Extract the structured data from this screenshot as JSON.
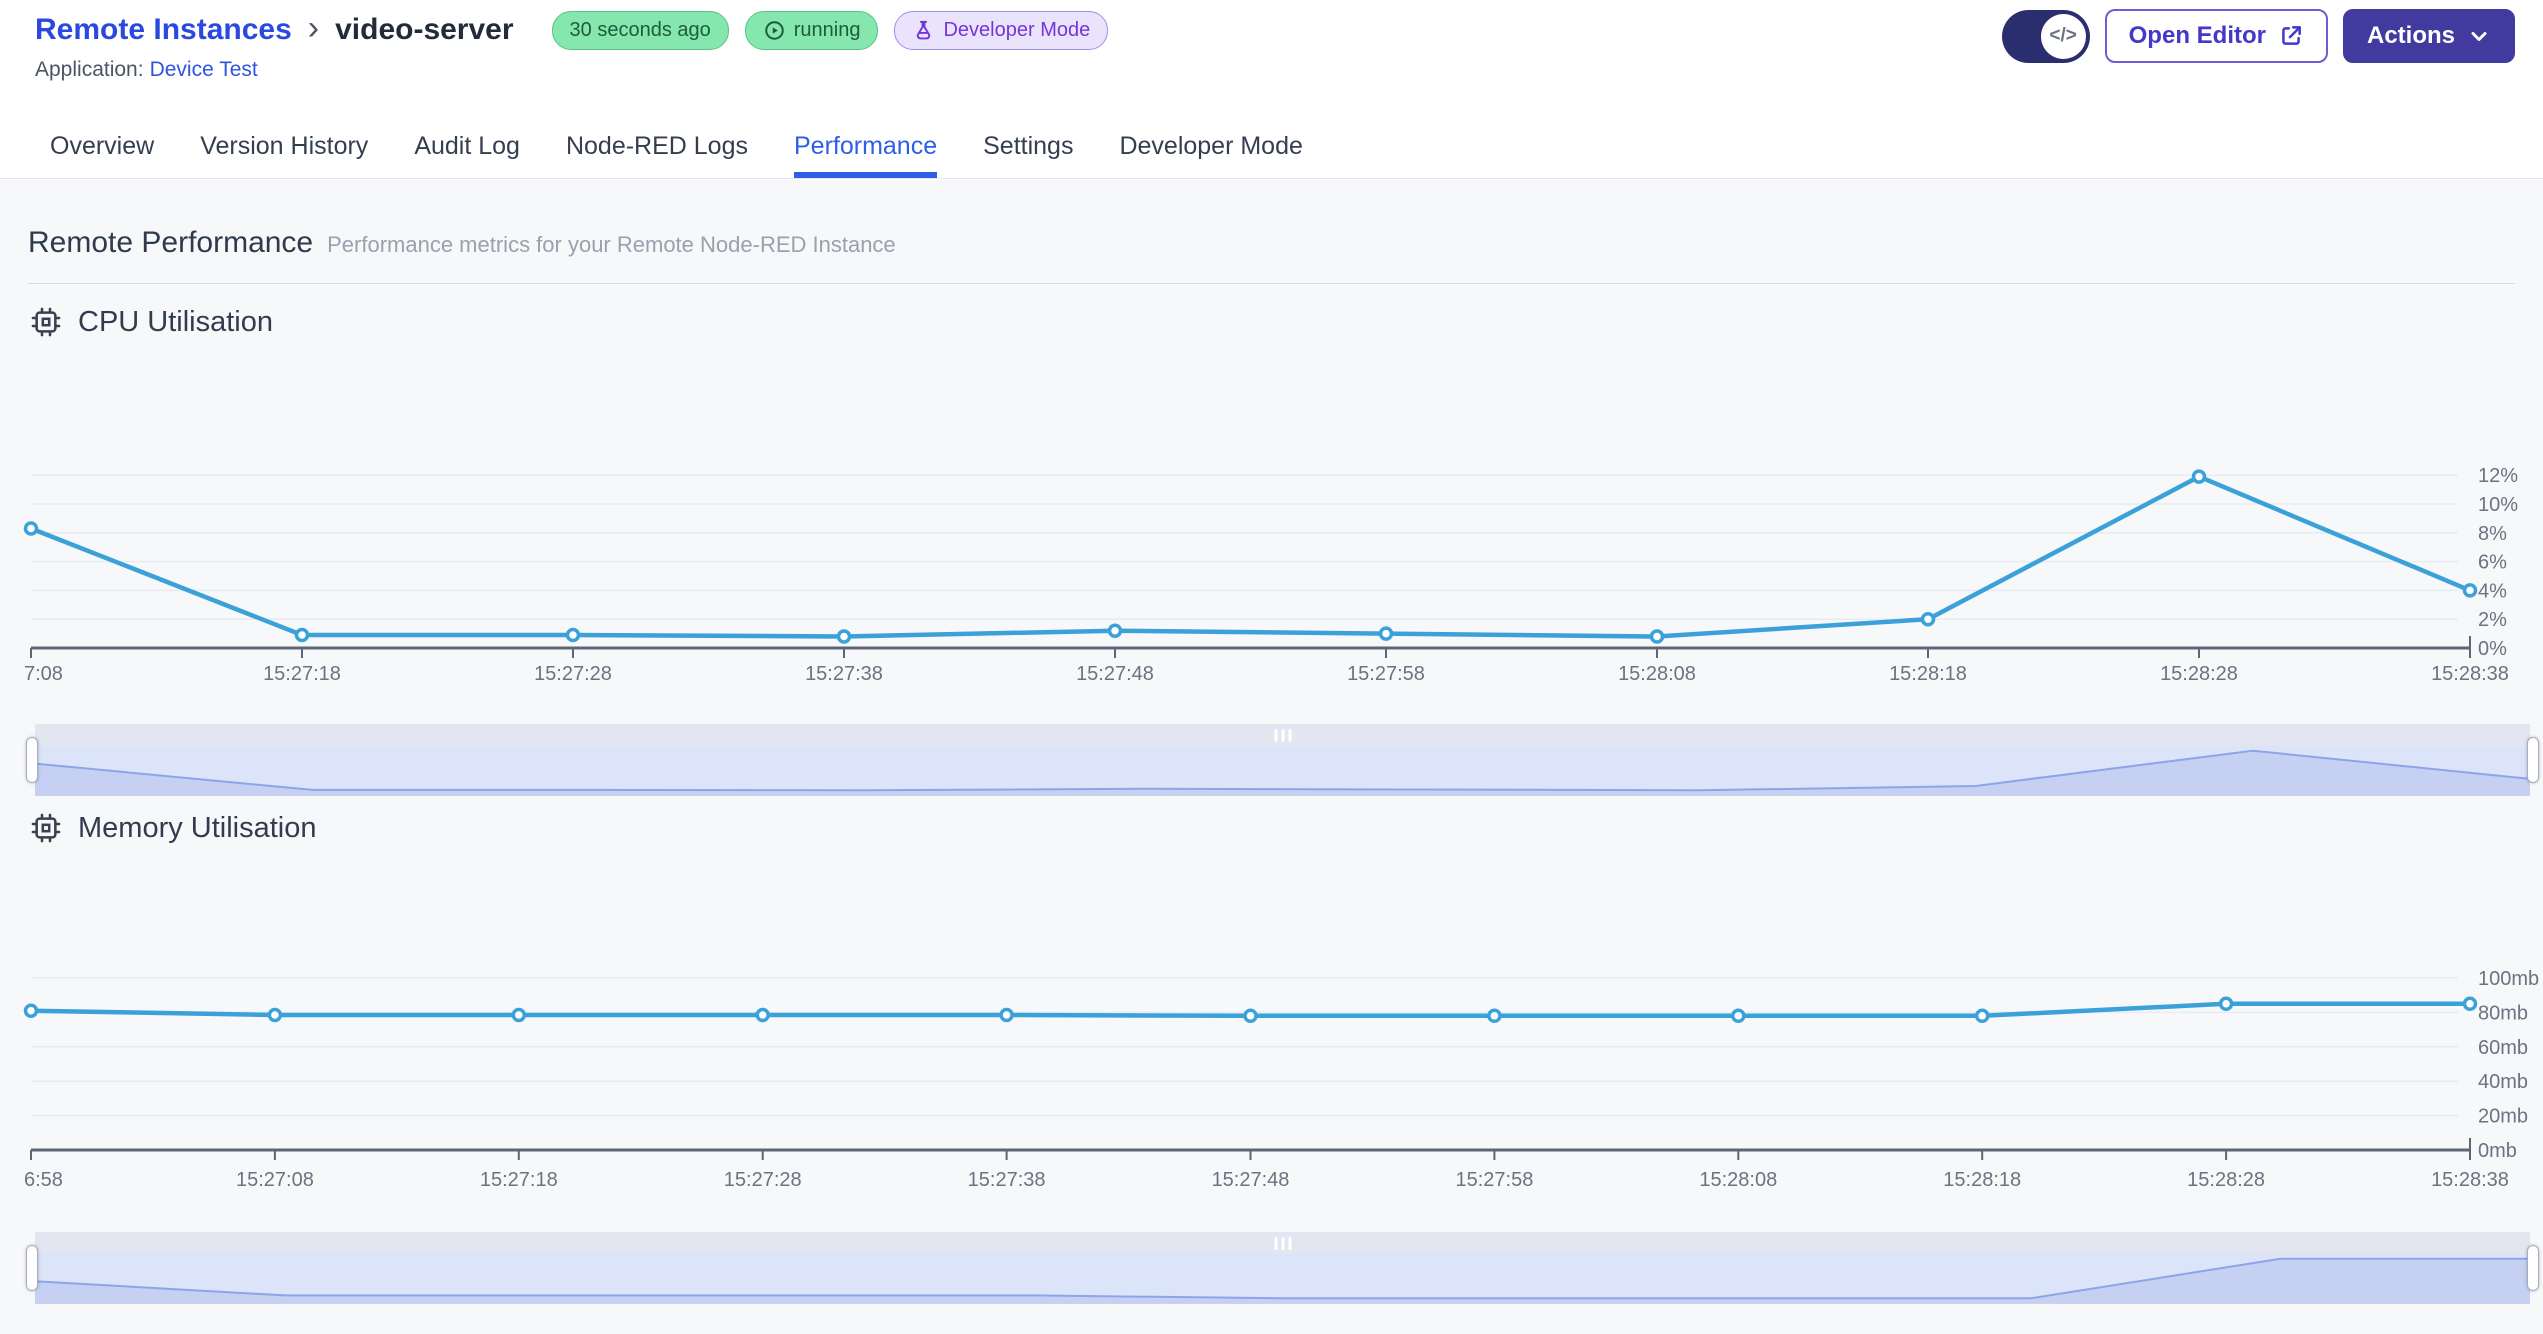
{
  "header": {
    "breadcrumb": {
      "parent": "Remote Instances",
      "separator": "›",
      "current": "video-server"
    },
    "badges": {
      "updated": "30 seconds ago",
      "status": "running",
      "mode": "Developer Mode"
    },
    "application_label": "Application:",
    "application_name": "Device Test",
    "code_toggle_glyph": "</>",
    "open_editor_label": "Open Editor",
    "actions_label": "Actions"
  },
  "tabs": [
    {
      "label": "Overview"
    },
    {
      "label": "Version History"
    },
    {
      "label": "Audit Log"
    },
    {
      "label": "Node-RED Logs"
    },
    {
      "label": "Performance"
    },
    {
      "label": "Settings"
    },
    {
      "label": "Developer Mode"
    }
  ],
  "active_tab_index": 4,
  "page": {
    "title": "Remote Performance",
    "subtitle": "Performance metrics for your Remote Node-RED Instance"
  },
  "sections": {
    "cpu": {
      "title": "CPU Utilisation"
    },
    "memory": {
      "title": "Memory Utilisation"
    }
  },
  "chart_data": [
    {
      "id": "cpu",
      "type": "line",
      "title": "CPU Utilisation",
      "x": [
        "7:08",
        "15:27:18",
        "15:27:28",
        "15:27:38",
        "15:27:48",
        "15:27:58",
        "15:28:08",
        "15:28:18",
        "15:28:28",
        "15:28:38"
      ],
      "values": [
        8.3,
        0.9,
        0.9,
        0.8,
        1.2,
        1.0,
        0.8,
        2.0,
        11.9,
        4.0
      ],
      "unit": "%",
      "y_ticks": [
        "0%",
        "2%",
        "4%",
        "6%",
        "8%",
        "10%",
        "12%"
      ],
      "y_step": 2,
      "ylim": [
        0,
        13
      ],
      "ylabel_side": "right",
      "grid": true,
      "legend": "none",
      "has_zoom_slider": true
    },
    {
      "id": "memory",
      "type": "line",
      "title": "Memory Utilisation",
      "x": [
        "6:58",
        "15:27:08",
        "15:27:18",
        "15:27:28",
        "15:27:38",
        "15:27:48",
        "15:27:58",
        "15:28:08",
        "15:28:18",
        "15:28:28",
        "15:28:38"
      ],
      "values": [
        81,
        78.5,
        78.5,
        78.5,
        78.5,
        78,
        78,
        78,
        78,
        85,
        85
      ],
      "unit": "mb",
      "y_ticks": [
        "0mb",
        "20mb",
        "40mb",
        "60mb",
        "80mb",
        "100mb"
      ],
      "y_step": 20,
      "ylim": [
        0,
        115
      ],
      "ylabel_side": "right",
      "grid": true,
      "legend": "none",
      "has_zoom_slider": true
    }
  ],
  "colors": {
    "accent_blue": "#2c5fe8",
    "link_blue": "#2b49e0",
    "line": "#3ba1d9",
    "grid": "#e6ecf2",
    "axis": "#5d6675",
    "axis_text": "#6b7280",
    "badge_green_bg": "#85e7ad",
    "badge_green_text": "#1d5c3a",
    "badge_purple_bg": "#eae3fc",
    "badge_purple_text": "#7435d9",
    "button_indigo": "#413a9f",
    "toggle_navy": "#2a2e6e",
    "brush_strip": "#e3e6f0",
    "brush_bg": "#dbe4f8",
    "brush_area": "#c5d0f3",
    "brush_line": "#8ea4e8",
    "content_bg": "#f7f8fa"
  }
}
